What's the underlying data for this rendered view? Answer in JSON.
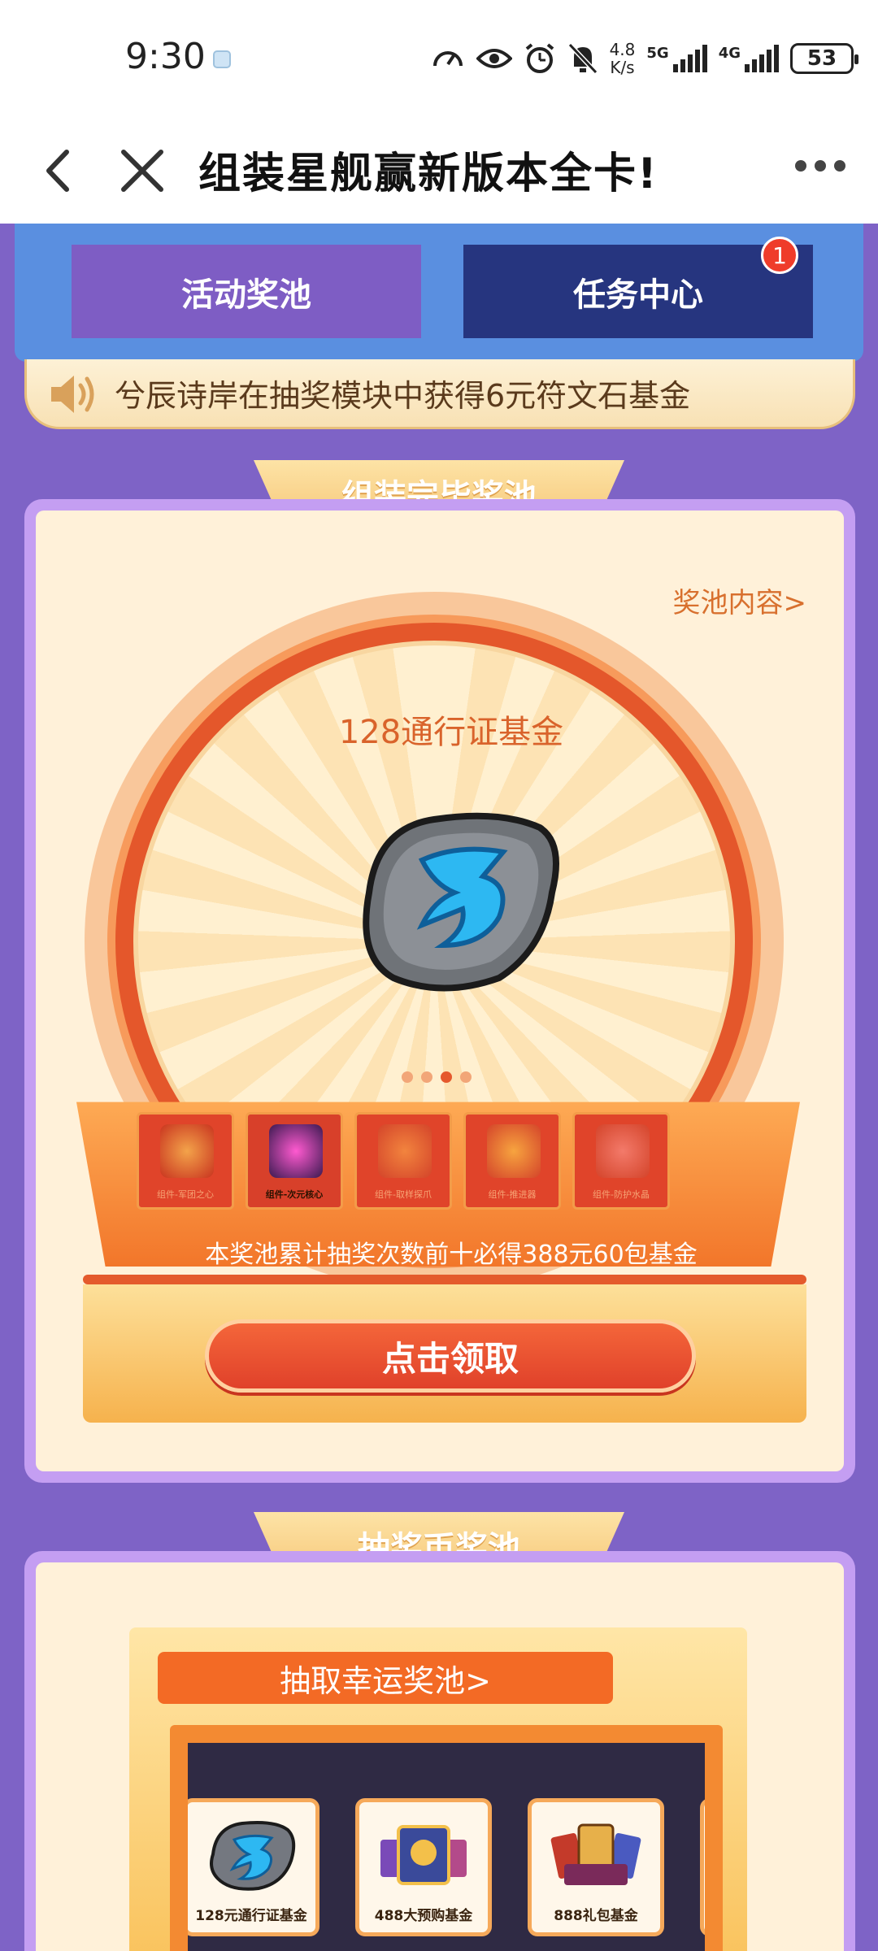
{
  "status_bar": {
    "time": "9:30",
    "net_speed_value": "4.8",
    "net_speed_unit": "K/s",
    "signal_1": "5G",
    "signal_2": "4G",
    "battery": "53"
  },
  "nav": {
    "title": "组装星舰赢新版本全卡!"
  },
  "tabs": {
    "pool_label": "活动奖池",
    "task_label": "任务中心",
    "task_badge": "1"
  },
  "marquee": {
    "text": "兮辰诗岸在抽奖模块中获得6元符文石基金"
  },
  "assembled_pool": {
    "header": "组装完毕奖池",
    "content_link": "奖池内容>",
    "prize_name": "128通行证基金",
    "carousel_dots": 4,
    "carousel_active": 3,
    "components": [
      {
        "label": "组件-军团之心",
        "active": false
      },
      {
        "label": "组件-次元核心",
        "active": true
      },
      {
        "label": "组件-取样探爪",
        "active": false
      },
      {
        "label": "组件-推进器",
        "active": false
      },
      {
        "label": "组件-防护水晶",
        "active": false
      }
    ],
    "guarantee_text": "本奖池累计抽奖次数前十必得388元60包基金",
    "claim_button": "点击领取"
  },
  "coin_pool": {
    "header": "抽奖币奖池",
    "lucky_button": "抽取幸运奖池>",
    "cards": [
      {
        "label": "128元通行证基金"
      },
      {
        "label": "488大预购基金"
      },
      {
        "label": "888礼包基金"
      }
    ]
  },
  "colors": {
    "page_bg": "#7e63c6",
    "tab_pool": "#7e5dc4",
    "tab_task": "#26357f",
    "accent_orange": "#e4572b",
    "badge_red": "#ef3c2a"
  }
}
